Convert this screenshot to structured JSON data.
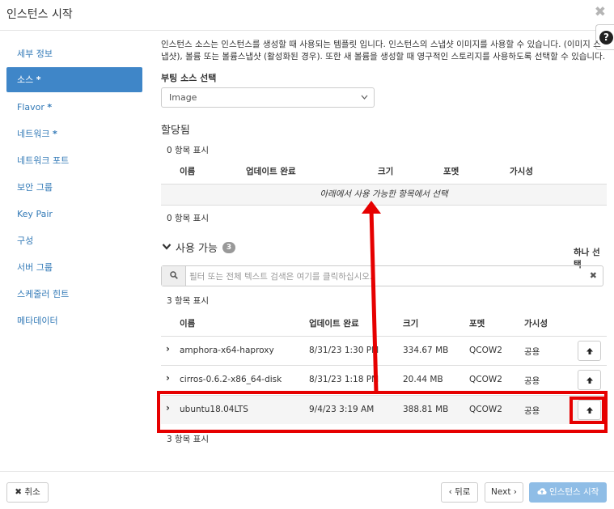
{
  "modal": {
    "title": "인스턴스 시작",
    "close": "✖",
    "help": "?"
  },
  "nav": {
    "items": [
      {
        "label": "세부 정보",
        "req": ""
      },
      {
        "label": "소스",
        "req": "*"
      },
      {
        "label": "Flavor",
        "req": "*"
      },
      {
        "label": "네트워크",
        "req": "*"
      },
      {
        "label": "네트워크 포트",
        "req": ""
      },
      {
        "label": "보안 그룹",
        "req": ""
      },
      {
        "label": "Key Pair",
        "req": ""
      },
      {
        "label": "구성",
        "req": ""
      },
      {
        "label": "서버 그룹",
        "req": ""
      },
      {
        "label": "스케줄러 힌트",
        "req": ""
      },
      {
        "label": "메타데이터",
        "req": ""
      }
    ]
  },
  "source": {
    "description": "인스턴스 소스는 인스턴스를 생성할 때 사용되는 템플릿 입니다. 인스턴스의 스냅샷 이미지를 사용할 수 있습니다. (이미지 스냅샷), 볼륨 또는 볼륨스냅샷 (활성화된 경우). 또한 새 볼륨을 생성할 때 영구적인 스토리지를 사용하도록 선택할 수 있습니다.",
    "boot_label": "부팅 소스 선택",
    "boot_value": "Image"
  },
  "allocated": {
    "title": "할당됨",
    "count_top": "0 항목 표시",
    "count_bottom": "0 항목 표시",
    "columns": [
      "이름",
      "업데이트 완료",
      "크기",
      "포멧",
      "가시성"
    ],
    "empty_text": "아래에서 사용 가능한 항목에서 선택"
  },
  "available": {
    "title": "사용 가능",
    "badge": "3",
    "pick_one": "하나 선택",
    "filter_placeholder": "필터 또는 전체 텍스트 검색은 여기를 클릭하십시오.",
    "count_top": "3 항목 표시",
    "count_bottom": "3 항목 표시",
    "columns": [
      "이름",
      "업데이트 완료",
      "크기",
      "포멧",
      "가시성"
    ],
    "rows": [
      {
        "name": "amphora-x64-haproxy",
        "updated": "8/31/23 1:30 PM",
        "size": "334.67 MB",
        "format": "QCOW2",
        "visibility": "공용"
      },
      {
        "name": "cirros-0.6.2-x86_64-disk",
        "updated": "8/31/23 1:18 PM",
        "size": "20.44 MB",
        "format": "QCOW2",
        "visibility": "공용"
      },
      {
        "name": "ubuntu18.04LTS",
        "updated": "9/4/23 3:19 AM",
        "size": "388.81 MB",
        "format": "QCOW2",
        "visibility": "공용"
      }
    ]
  },
  "footer": {
    "cancel": "취소",
    "back": "‹ 뒤로",
    "next": "Next ›",
    "launch": "인스턴스 시작"
  },
  "colors": {
    "accent": "#3f86c8",
    "highlight": "#e60000",
    "launch_disabled": "#8fbde6"
  }
}
